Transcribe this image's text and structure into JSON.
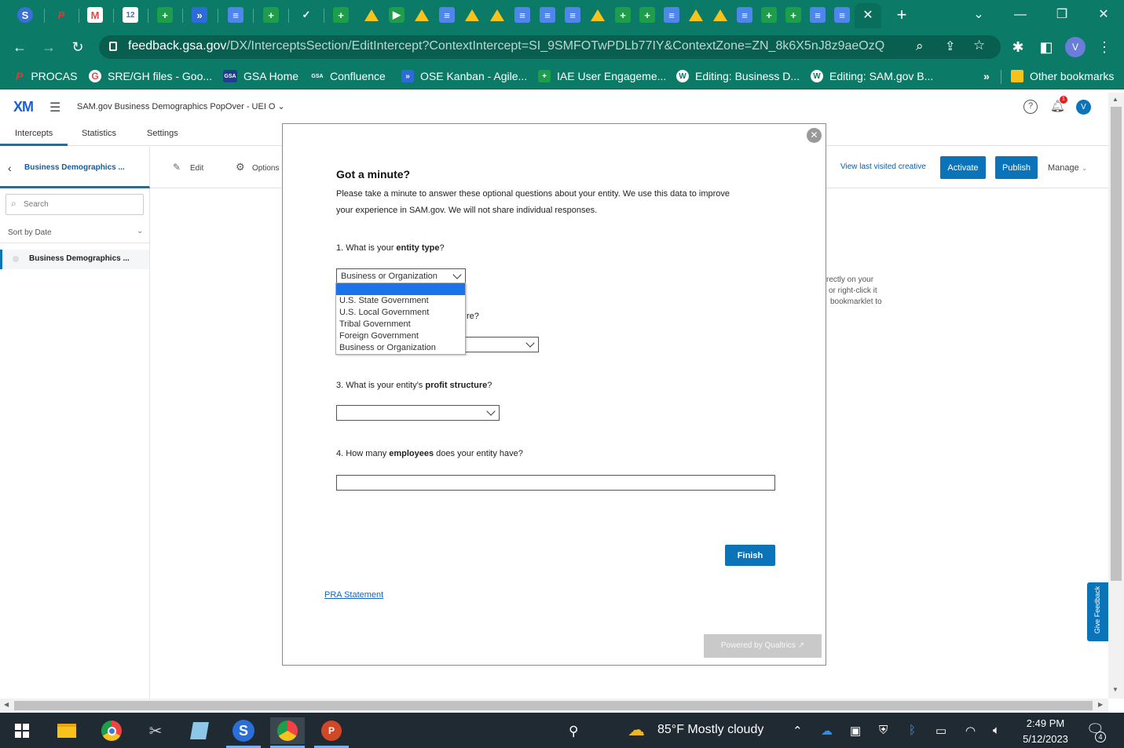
{
  "browser": {
    "tab_icons": [
      "s-app-icon",
      "p-app-icon",
      "gmail-icon",
      "calendar-icon",
      "sheets-icon",
      "jira-icon",
      "docs-icon",
      "sheets-icon",
      "check-icon",
      "sheets-icon",
      "drive-icon",
      "meet-icon",
      "drive-icon",
      "docs-icon",
      "drive-icon",
      "drive-icon",
      "docs-icon",
      "docs-icon",
      "docs-icon",
      "drive-icon",
      "sheets-icon",
      "sheets-icon",
      "docs-icon",
      "drive-icon",
      "drive-icon",
      "docs-icon",
      "sheets-icon",
      "sheets-icon",
      "docs-icon",
      "docs-icon"
    ],
    "url_host": "feedback.gsa.gov",
    "url_path": "/DX/InterceptsSection/EditIntercept?ContextIntercept=SI_9SMFOTwPDLb77IY&ContextZone=ZN_8k6X5nJ8z9aeOzQ",
    "bookmarks": [
      "PROCAS",
      "SRE/GH files - Goo...",
      "GSA Home",
      "Confluence",
      "OSE Kanban - Agile...",
      "IAE User Engageme...",
      "Editing: Business D...",
      "Editing: SAM.gov B..."
    ],
    "bookmarks_overflow": "»",
    "other_bookmarks": "Other bookmarks",
    "bookmark_gsa_badge": "GSA",
    "bookmark_gsa_badge_small": "GSA",
    "calendar_day": "12",
    "profile_initial": "V"
  },
  "xm": {
    "logo": "XM",
    "project_title": "SAM.gov Business Demographics PopOver - UEI O",
    "notification_count": "1",
    "user_initial": "V",
    "tabs": [
      "Intercepts",
      "Statistics",
      "Settings"
    ],
    "active_tab": "Intercepts",
    "back_label": "Business Demographics ...",
    "edit_label": "Edit",
    "options_label": "Options",
    "view_last_label": "View last visited creative",
    "activate_label": "Activate",
    "publish_label": "Publish",
    "manage_label": "Manage",
    "search_placeholder": "Search",
    "sort_label": "Sort by Date",
    "list_item": "Business Demographics ...",
    "bg_text_lines": [
      "rectly on your",
      "or right-click it",
      "bookmarklet to"
    ],
    "feedback_tab": "Give Feedback"
  },
  "modal": {
    "heading": "Got a minute?",
    "intro_line1": "Please take a minute to answer these optional questions about your entity. We use this data to improve",
    "intro_line2": "your experience in SAM.gov. We will not share individual responses.",
    "q1_pre": "1. What is your ",
    "q1_bold": "entity type",
    "q1_post": "?",
    "q1_selected": "Business or Organization",
    "q1_options": [
      "",
      "U.S. State Government",
      "U.S. Local Government",
      "Tribal Government",
      "Foreign Government",
      "Business or Organization"
    ],
    "q2_visible_tail": "re?",
    "q3_pre": "3. What is your entity's ",
    "q3_bold": "profit structure",
    "q3_post": "?",
    "q4_pre": "4. How many ",
    "q4_bold": "employees",
    "q4_post": " does your entity have?",
    "finish_label": "Finish",
    "pra_link": "PRA Statement",
    "powered_by": "Powered by Qualtrics ↗"
  },
  "taskbar": {
    "weather": "85°F  Mostly cloudy",
    "time": "2:49 PM",
    "date": "5/12/2023",
    "notif_count": "4",
    "powerpoint_letter": "P"
  },
  "colors": {
    "chrome_green": "#0b7a66",
    "accent_blue": "#0b74b8",
    "taskbar": "#1f2a33"
  }
}
